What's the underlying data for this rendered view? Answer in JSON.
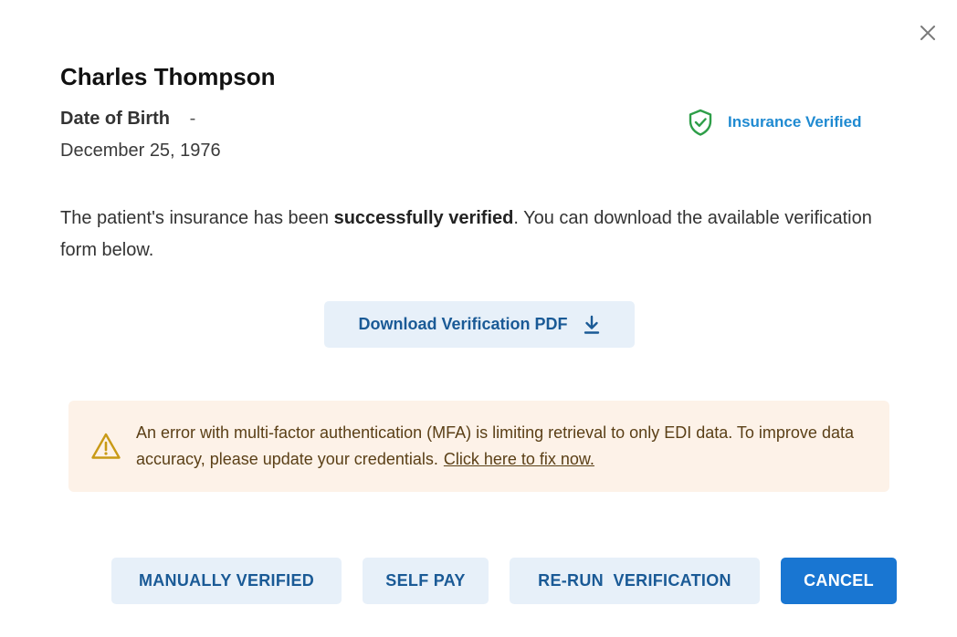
{
  "patient": {
    "name": "Charles Thompson",
    "dob_label": "Date of Birth",
    "dob_separator": "-",
    "dob_value": "December 25, 1976"
  },
  "status": {
    "icon": "shield-check-icon",
    "label": "Insurance Verified",
    "color": "#1f8ad1",
    "icon_color": "#2e9e48"
  },
  "message": {
    "prefix": "The patient's insurance has been ",
    "emphasis": "successfully verified",
    "suffix": ". You can download the available verification form below."
  },
  "download": {
    "label": "Download Verification PDF",
    "icon": "download-icon"
  },
  "warning": {
    "icon": "warning-triangle-icon",
    "text": "An error with multi-factor authentication (MFA) is limiting retrieval to only EDI data. To improve data accuracy, please update your credentials.",
    "link": "Click here to fix now.",
    "background": "#fdf2e8",
    "icon_color": "#c99a16"
  },
  "actions": {
    "manually_verified": "MANUALLY VERIFIED",
    "self_pay": "SELF PAY",
    "rerun_verification": "RE-RUN  VERIFICATION",
    "cancel": "CANCEL"
  },
  "colors": {
    "primary": "#1976d2",
    "secondary_bg": "#e7f0f9",
    "secondary_text": "#1a5a96"
  }
}
